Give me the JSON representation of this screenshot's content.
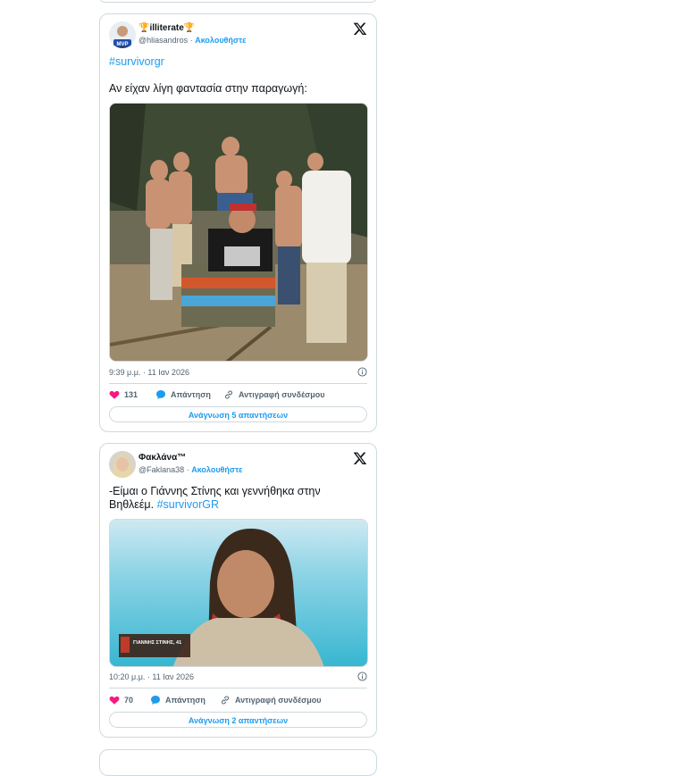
{
  "tweets": [
    {
      "display_name": "🏆illiterate🏆",
      "handle": "@hliasandros",
      "separator": "·",
      "follow_label": "Ακολουθήστε",
      "hashtag": "#survivorgr",
      "text": "Αν είχαν λίγη φαντασία στην παραγωγή:",
      "timestamp": "9:39 μ.μ. · 11 Ιαν 2026",
      "likes": "131",
      "reply_label": "Απάντηση",
      "copy_link_label": "Αντιγραφή συνδέσμου",
      "read_replies_label": "Ανάγνωση 5 απαντήσεων",
      "avatar_badge": "MVP"
    },
    {
      "display_name": "Φακλάνα™",
      "handle": "@Faklana38",
      "separator": "·",
      "follow_label": "Ακολουθήστε",
      "text": "-Είμαι ο Γιάννης Στίνης και γεννήθηκα στην Βηθλεέμ.",
      "hashtag": "#survivorGR",
      "timestamp": "10:20 μ.μ. · 11 Ιαν 2026",
      "likes": "70",
      "reply_label": "Απάντηση",
      "copy_link_label": "Αντιγραφή συνδέσμου",
      "read_replies_label": "Ανάγνωση 2 απαντήσεων",
      "lower_third_name": "ΓΙΑΝΝΗΣ ΣΤΙΝΗΣ, 41"
    }
  ],
  "colors": {
    "accent": "#1d9bf0",
    "like": "#f91880",
    "border": "#cfd9de",
    "muted": "#536471"
  },
  "icons": [
    "x-logo-icon",
    "heart-icon",
    "reply-bubble-icon",
    "link-icon",
    "info-icon"
  ]
}
